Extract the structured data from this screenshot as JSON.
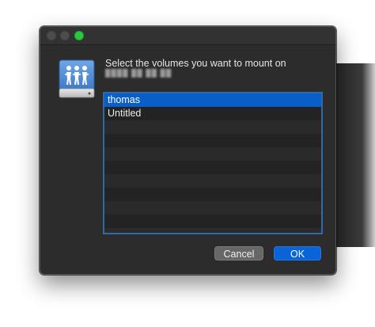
{
  "dialog": {
    "prompt": "Select the volumes you want to mount on",
    "server_name": "████ ██ ██ ██",
    "icon": "shared-network-drive-icon",
    "window_controls": [
      "close",
      "minimize",
      "zoom"
    ]
  },
  "volumes": [
    {
      "label": "thomas",
      "selected": true
    },
    {
      "label": "Untitled",
      "selected": false
    }
  ],
  "buttons": {
    "cancel_label": "Cancel",
    "ok_label": "OK"
  },
  "colors": {
    "selection": "#0a5ec8",
    "list_border": "#2f6aa8",
    "ok_button": "#0a64d8",
    "zoom_light": "#28c840"
  }
}
